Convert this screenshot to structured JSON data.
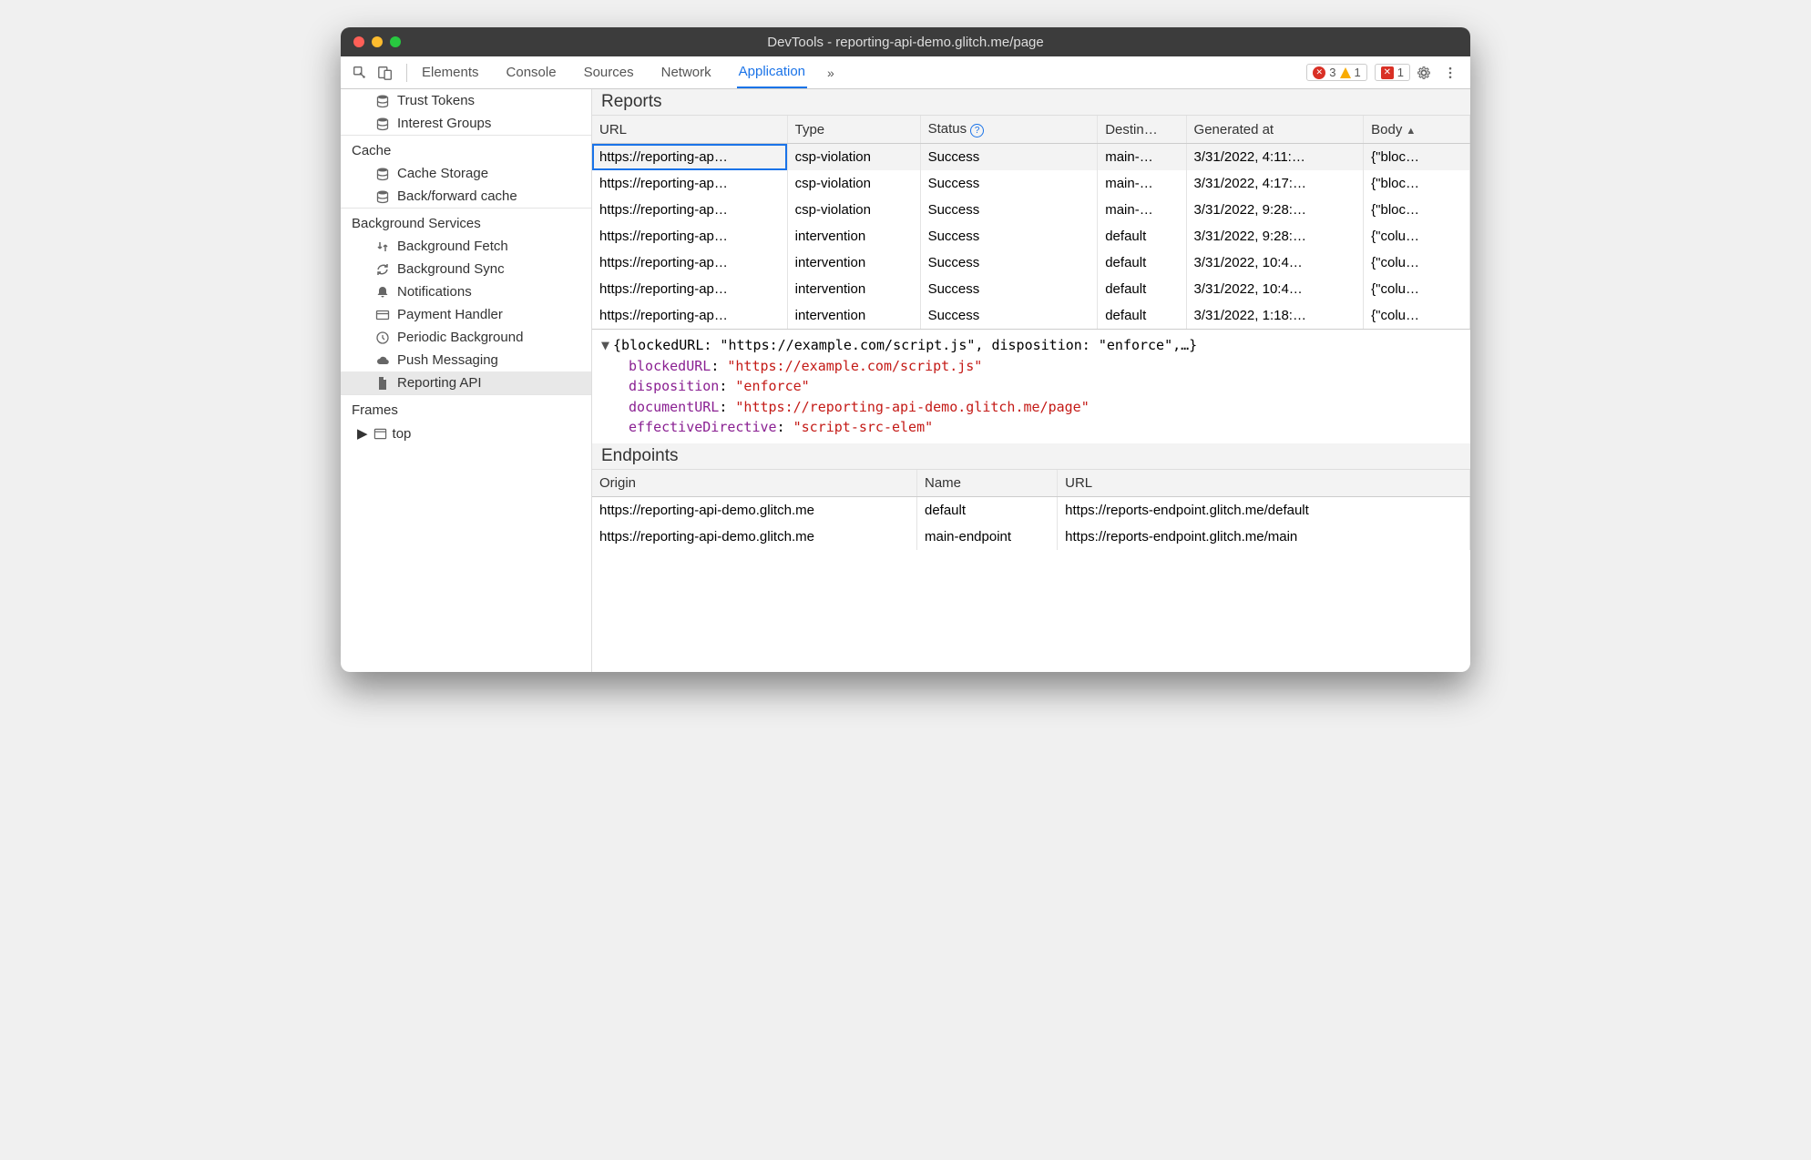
{
  "window_title": "DevTools - reporting-api-demo.glitch.me/page",
  "tabs": [
    "Elements",
    "Console",
    "Sources",
    "Network",
    "Application"
  ],
  "active_tab": "Application",
  "badges": {
    "errors": 3,
    "warnings": 1,
    "blocked": 1
  },
  "sidebar_top": [
    {
      "label": "Trust Tokens",
      "icon": "db"
    },
    {
      "label": "Interest Groups",
      "icon": "db"
    }
  ],
  "sidebar_groups": [
    {
      "title": "Cache",
      "items": [
        {
          "label": "Cache Storage",
          "icon": "db"
        },
        {
          "label": "Back/forward cache",
          "icon": "db"
        }
      ]
    },
    {
      "title": "Background Services",
      "items": [
        {
          "label": "Background Fetch",
          "icon": "fetch"
        },
        {
          "label": "Background Sync",
          "icon": "sync"
        },
        {
          "label": "Notifications",
          "icon": "bell"
        },
        {
          "label": "Payment Handler",
          "icon": "card"
        },
        {
          "label": "Periodic Background",
          "icon": "clock"
        },
        {
          "label": "Push Messaging",
          "icon": "cloud"
        },
        {
          "label": "Reporting API",
          "icon": "file",
          "selected": true
        }
      ]
    }
  ],
  "frames_title": "Frames",
  "frames_root": "top",
  "reports_title": "Reports",
  "reports_cols": [
    "URL",
    "Type",
    "Status",
    "Destin…",
    "Generated at",
    "Body"
  ],
  "reports_rows": [
    {
      "url": "https://reporting-ap…",
      "type": "csp-violation",
      "status": "Success",
      "dest": "main-…",
      "gen": "3/31/2022, 4:11:…",
      "body": "{\"bloc…",
      "selected": true
    },
    {
      "url": "https://reporting-ap…",
      "type": "csp-violation",
      "status": "Success",
      "dest": "main-…",
      "gen": "3/31/2022, 4:17:…",
      "body": "{\"bloc…"
    },
    {
      "url": "https://reporting-ap…",
      "type": "csp-violation",
      "status": "Success",
      "dest": "main-…",
      "gen": "3/31/2022, 9:28:…",
      "body": "{\"bloc…"
    },
    {
      "url": "https://reporting-ap…",
      "type": "intervention",
      "status": "Success",
      "dest": "default",
      "gen": "3/31/2022, 9:28:…",
      "body": "{\"colu…"
    },
    {
      "url": "https://reporting-ap…",
      "type": "intervention",
      "status": "Success",
      "dest": "default",
      "gen": "3/31/2022, 10:4…",
      "body": "{\"colu…"
    },
    {
      "url": "https://reporting-ap…",
      "type": "intervention",
      "status": "Success",
      "dest": "default",
      "gen": "3/31/2022, 10:4…",
      "body": "{\"colu…"
    },
    {
      "url": "https://reporting-ap…",
      "type": "intervention",
      "status": "Success",
      "dest": "default",
      "gen": "3/31/2022, 1:18:…",
      "body": "{\"colu…"
    }
  ],
  "detail_summary": "{blockedURL: \"https://example.com/script.js\", disposition: \"enforce\",…}",
  "detail_props": [
    {
      "k": "blockedURL",
      "v": "\"https://example.com/script.js\""
    },
    {
      "k": "disposition",
      "v": "\"enforce\""
    },
    {
      "k": "documentURL",
      "v": "\"https://reporting-api-demo.glitch.me/page\""
    },
    {
      "k": "effectiveDirective",
      "v": "\"script-src-elem\""
    }
  ],
  "endpoints_title": "Endpoints",
  "endpoints_cols": [
    "Origin",
    "Name",
    "URL"
  ],
  "endpoints_rows": [
    {
      "origin": "https://reporting-api-demo.glitch.me",
      "name": "default",
      "url": "https://reports-endpoint.glitch.me/default"
    },
    {
      "origin": "https://reporting-api-demo.glitch.me",
      "name": "main-endpoint",
      "url": "https://reports-endpoint.glitch.me/main"
    }
  ]
}
